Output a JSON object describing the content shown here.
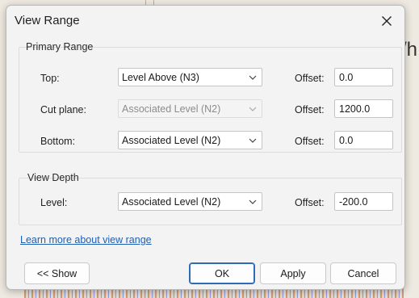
{
  "window": {
    "title": "View Range"
  },
  "background": {
    "partial_text": "/h"
  },
  "primary_range": {
    "label": "Primary Range",
    "rows": [
      {
        "label": "Top:",
        "select_value": "Level Above (N3)",
        "enabled": true,
        "offset_label": "Offset:",
        "offset_value": "0.0"
      },
      {
        "label": "Cut plane:",
        "select_value": "Associated Level (N2)",
        "enabled": false,
        "offset_label": "Offset:",
        "offset_value": "1200.0"
      },
      {
        "label": "Bottom:",
        "select_value": "Associated Level (N2)",
        "enabled": true,
        "offset_label": "Offset:",
        "offset_value": "0.0"
      }
    ]
  },
  "view_depth": {
    "label": "View Depth",
    "level_label": "Level:",
    "select_value": "Associated Level (N2)",
    "offset_label": "Offset:",
    "offset_value": "-200.0"
  },
  "link": {
    "text": "Learn more about view range"
  },
  "buttons": {
    "show": "<< Show",
    "ok": "OK",
    "apply": "Apply",
    "cancel": "Cancel"
  },
  "colors": {
    "link": "#1f5fb3",
    "primary_border": "#2d6bb5",
    "dialog_bg": "#f3f3f3"
  }
}
